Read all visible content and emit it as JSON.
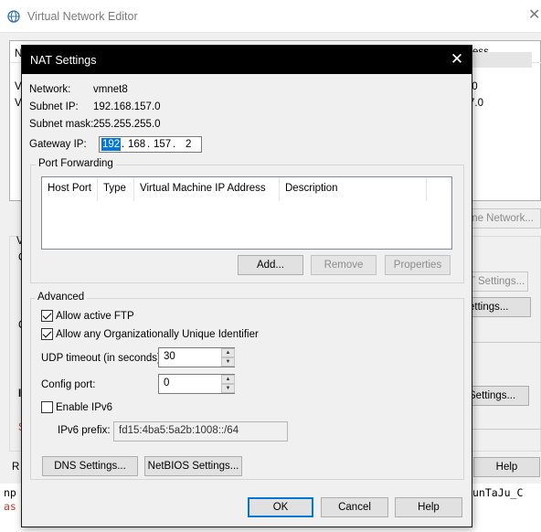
{
  "background": {
    "title": "Virtual Network Editor",
    "partial_texts": {
      "col_tail": "ess",
      "row_n": "N",
      "row_v1": "V",
      "row_v2": "V",
      "val1": ".0",
      "val2": "7.0",
      "side_v": "V",
      "side_c1": "C",
      "side_c2": "C",
      "side_i": "I",
      "side_s": "S",
      "side_r": "R",
      "console_left1": "np",
      "console_left2": "as",
      "console_right": "unTaJu_C"
    },
    "buttons": {
      "rename_network": "me Network...",
      "nat_settings": "T Settings...",
      "dhcp_settings": "ettings...",
      "settings3": "Settings...",
      "help": "Help"
    }
  },
  "dialog": {
    "title": "NAT Settings",
    "network_label": "Network:",
    "network_value": "vmnet8",
    "subnet_ip_label": "Subnet IP:",
    "subnet_ip_value": "192.168.157.0",
    "subnet_mask_label": "Subnet mask:",
    "subnet_mask_value": "255.255.255.0",
    "gateway_label": "Gateway IP:",
    "gateway_octets": [
      "192",
      "168",
      "157",
      "2"
    ],
    "port_forwarding": {
      "label": "Port Forwarding",
      "columns": [
        "Host Port",
        "Type",
        "Virtual Machine IP Address",
        "Description"
      ],
      "add_label": "Add...",
      "remove_label": "Remove",
      "properties_label": "Properties"
    },
    "advanced": {
      "label": "Advanced",
      "allow_ftp_label": "Allow active FTP",
      "allow_ftp_checked": true,
      "allow_oui_label": "Allow any Organizationally Unique Identifier",
      "allow_oui_checked": true,
      "udp_timeout_label": "UDP timeout (in seconds):",
      "udp_timeout_value": "30",
      "config_port_label": "Config port:",
      "config_port_value": "0",
      "enable_ipv6_label": "Enable IPv6",
      "enable_ipv6_checked": false,
      "ipv6_prefix_label": "IPv6 prefix:",
      "ipv6_prefix_value": "fd15:4ba5:5a2b:1008::/64",
      "dns_settings_label": "DNS Settings...",
      "netbios_settings_label": "NetBIOS Settings..."
    },
    "ok_label": "OK",
    "cancel_label": "Cancel",
    "help_label": "Help"
  }
}
